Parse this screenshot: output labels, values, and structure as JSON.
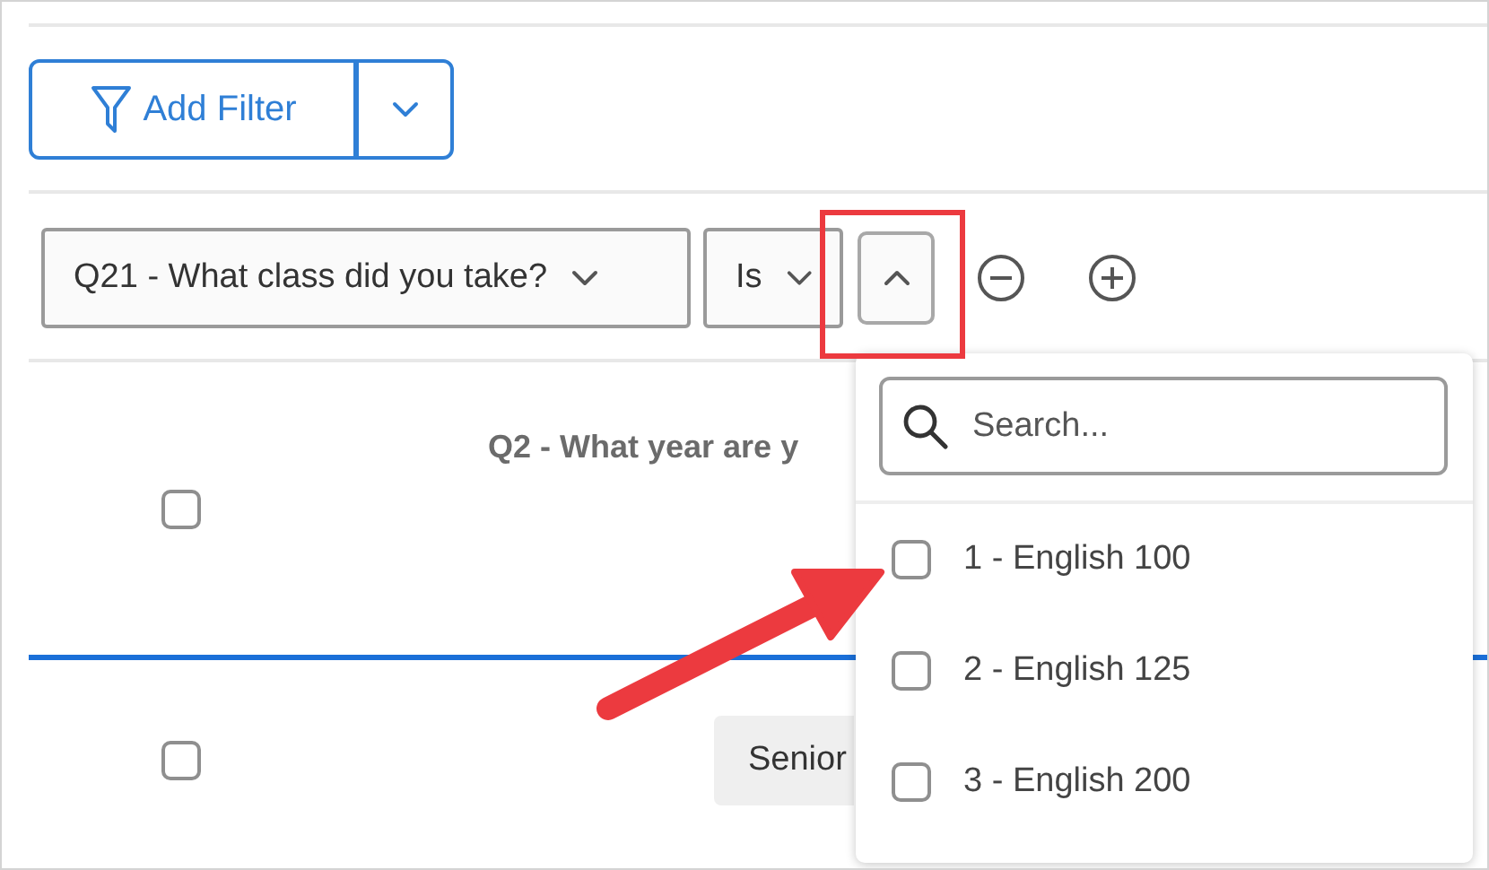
{
  "add_filter": {
    "label": "Add Filter"
  },
  "filter": {
    "question": "Q21 - What class did you take?",
    "operator": "Is",
    "value_open": true
  },
  "table": {
    "header": "Q2 - What year are y",
    "header_checked": false,
    "rows": [
      {
        "checked": false,
        "value": "Senior"
      }
    ]
  },
  "dropdown": {
    "search_placeholder": "Search...",
    "options": [
      {
        "label": "1 - English 100",
        "checked": false
      },
      {
        "label": "2 - English 125",
        "checked": false
      },
      {
        "label": "3 - English 200",
        "checked": false
      }
    ]
  },
  "annotations": {
    "highlight_value_button": true,
    "arrow_to_first_option": true
  }
}
